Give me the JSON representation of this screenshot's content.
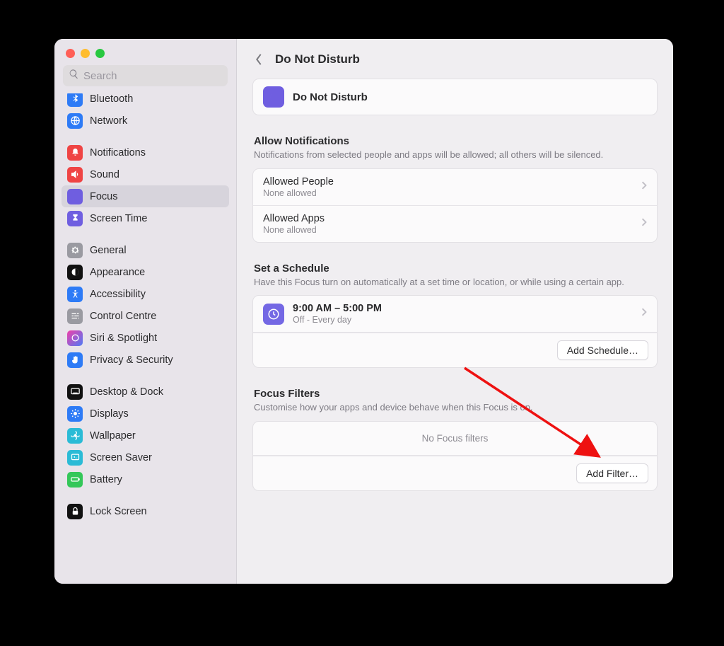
{
  "search": {
    "placeholder": "Search"
  },
  "sidebar": {
    "g1": [
      {
        "label": "Bluetooth",
        "color": "#2e7bf6"
      },
      {
        "label": "Network",
        "color": "#2e7bf6"
      }
    ],
    "g2": [
      {
        "label": "Notifications",
        "color": "#ef4444"
      },
      {
        "label": "Sound",
        "color": "#ef4444"
      },
      {
        "label": "Focus",
        "color": "#6f5ee0"
      },
      {
        "label": "Screen Time",
        "color": "#6f5ee0"
      }
    ],
    "g3": [
      {
        "label": "General",
        "color": "#9a9aa1"
      },
      {
        "label": "Appearance",
        "color": "#111111"
      },
      {
        "label": "Accessibility",
        "color": "#2e7bf6"
      },
      {
        "label": "Control Centre",
        "color": "#9a9aa1"
      },
      {
        "label": "Siri & Spotlight",
        "color": "#111111"
      },
      {
        "label": "Privacy & Security",
        "color": "#2e7bf6"
      }
    ],
    "g4": [
      {
        "label": "Desktop & Dock",
        "color": "#111111"
      },
      {
        "label": "Displays",
        "color": "#2e7bf6"
      },
      {
        "label": "Wallpaper",
        "color": "#2bbbd6"
      },
      {
        "label": "Screen Saver",
        "color": "#2bbbd6"
      },
      {
        "label": "Battery",
        "color": "#34c759"
      }
    ],
    "g5": [
      {
        "label": "Lock Screen",
        "color": "#111111"
      }
    ]
  },
  "header": {
    "title": "Do Not Disturb"
  },
  "hero": {
    "label": "Do Not Disturb"
  },
  "allow": {
    "title": "Allow Notifications",
    "desc": "Notifications from selected people and apps will be allowed; all others will be silenced.",
    "rows": [
      {
        "pri": "Allowed People",
        "sec": "None allowed"
      },
      {
        "pri": "Allowed Apps",
        "sec": "None allowed"
      }
    ]
  },
  "schedule": {
    "title": "Set a Schedule",
    "desc": "Have this Focus turn on automatically at a set time or location, or while using a certain app.",
    "row": {
      "pri": "9:00 AM – 5:00 PM",
      "sec": "Off - Every day"
    },
    "add": "Add Schedule…"
  },
  "filters": {
    "title": "Focus Filters",
    "desc": "Customise how your apps and device behave when this Focus is on.",
    "empty": "No Focus filters",
    "add": "Add Filter…"
  }
}
